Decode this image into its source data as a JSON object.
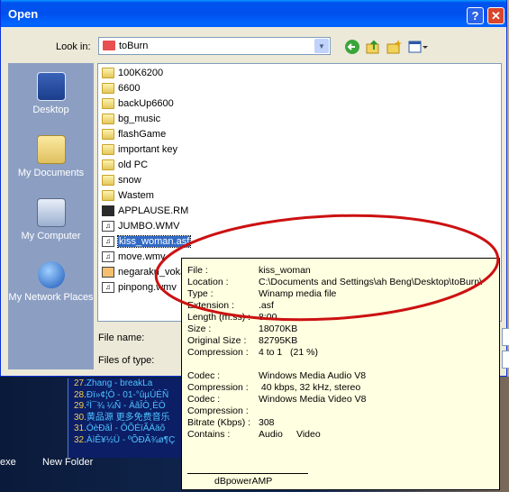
{
  "window": {
    "title": "Open",
    "help_glyph": "?",
    "close_glyph": "✕"
  },
  "lookin": {
    "label": "Look in:",
    "value": "toBurn"
  },
  "places": [
    {
      "label": "Desktop"
    },
    {
      "label": "My Documents"
    },
    {
      "label": "My Computer"
    },
    {
      "label": "My Network Places"
    }
  ],
  "files": [
    {
      "name": "100K6200",
      "type": "folder"
    },
    {
      "name": "6600",
      "type": "folder"
    },
    {
      "name": "backUp6600",
      "type": "folder"
    },
    {
      "name": "bg_music",
      "type": "folder"
    },
    {
      "name": "flashGame",
      "type": "folder"
    },
    {
      "name": "important key",
      "type": "folder"
    },
    {
      "name": "old PC",
      "type": "folder"
    },
    {
      "name": "snow",
      "type": "folder"
    },
    {
      "name": "Wastem",
      "type": "folder"
    },
    {
      "name": "APPLAUSE.RM",
      "type": "rm"
    },
    {
      "name": "JUMBO.WMV",
      "type": "media"
    },
    {
      "name": "kiss_woman.asf",
      "type": "media",
      "selected": true
    },
    {
      "name": "move.wmv",
      "type": "media"
    },
    {
      "name": "negaraku_vokal",
      "type": "media"
    },
    {
      "name": "pinpong.wmv",
      "type": "media"
    }
  ],
  "filename_label": "File name:",
  "filetype_label": "Files of type:",
  "tooltip": {
    "rows": [
      {
        "k": "File :",
        "v": "kiss_woman"
      },
      {
        "k": "Location :",
        "v": "C:\\Documents and Settings\\ah Beng\\Desktop\\toBurn\\"
      },
      {
        "k": "Type :",
        "v": "Winamp media file"
      },
      {
        "k": "Extension :",
        "v": ".asf"
      },
      {
        "k": "Length (m:ss) :",
        "v": "8:00"
      },
      {
        "k": "Size :",
        "v": "18070KB"
      },
      {
        "k": "Original Size :",
        "v": "82795KB"
      },
      {
        "k": "Compression :",
        "v": "4 to 1   (21 %)"
      },
      {
        "k": "",
        "v": ""
      },
      {
        "k": "Codec :",
        "v": "Windows Media Audio V8"
      },
      {
        "k": "Compression :",
        "v": " 40 kbps, 32 kHz, stereo"
      },
      {
        "k": "Codec :",
        "v": "Windows Media Video V8"
      },
      {
        "k": "Compression :",
        "v": ""
      },
      {
        "k": "Bitrate (Kbps) :",
        "v": "308"
      },
      {
        "k": "Contains :",
        "v": "Audio",
        "v2": "Video"
      }
    ],
    "signature": "dBpowerAMP"
  },
  "playlist": [
    {
      "num": "27.",
      "text": "Zhang - breakLa"
    },
    {
      "num": "28.",
      "text": "Ðï»¢¦Ó - 01-°ûµÚÉÑ"
    },
    {
      "num": "29.",
      "text": "²Ì¯¾ ¼Ñ - ÄãÎÒ¸ÈÒ"
    },
    {
      "num": "30.",
      "text": "黄品源 更多免费音乐"
    },
    {
      "num": "31.",
      "text": "ÓèÐãÌ - ÔÕÉïÃÄäõ"
    },
    {
      "num": "32.",
      "text": "ÀìÊ¥½Ü - ºÕÐÃ¾ø¶Ç"
    }
  ],
  "taskbar": {
    "left": "exe",
    "right": "New Folder"
  },
  "colors": {
    "title_bar": "#0053ee",
    "places_bar": "#8c9fc3",
    "selection": "#316ac5",
    "tooltip_bg": "#ffffe1",
    "annotation": "#cc1111"
  }
}
